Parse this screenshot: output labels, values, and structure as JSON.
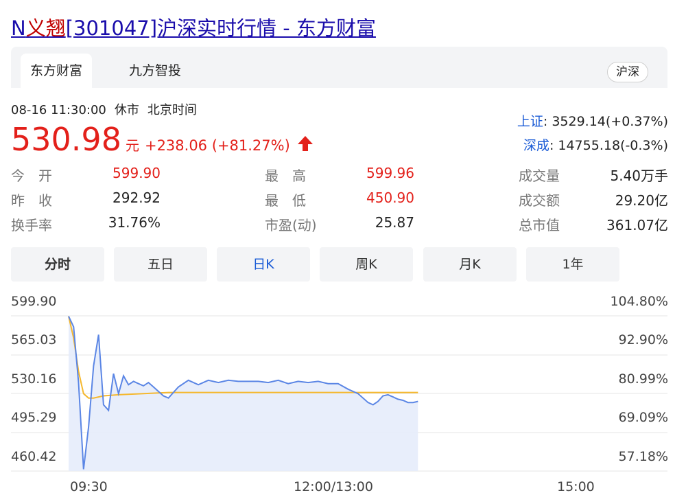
{
  "page_title": {
    "prefix": "N",
    "highlight": "义翘",
    "suffix": "[301047]沪深实时行情 - 东方财富"
  },
  "tabs": [
    {
      "label": "东方财富",
      "active": true
    },
    {
      "label": "九方智投",
      "active": false
    }
  ],
  "market_badge": "沪深",
  "status": {
    "datetime": "08-16 11:30:00",
    "state": "休市",
    "timezone": "北京时间"
  },
  "price": {
    "value": "530.98",
    "unit": "元",
    "change": "+238.06 (+81.27%)",
    "direction": "up",
    "up_color": "#e3201a"
  },
  "indices": [
    {
      "name": "上证",
      "value": ": 3529.14(+0.37%)"
    },
    {
      "name": "深成",
      "value": ": 14755.18(-0.3%)"
    }
  ],
  "quote_stats": [
    [
      {
        "label": "今　开",
        "value": "599.90",
        "color": "red"
      },
      {
        "label": "昨　收",
        "value": "292.92",
        "color": "dark"
      },
      {
        "label": "换手率",
        "value": "31.76%",
        "color": "dark"
      }
    ],
    [
      {
        "label": "最　高",
        "value": "599.96",
        "color": "red"
      },
      {
        "label": "最　低",
        "value": "450.90",
        "color": "red"
      },
      {
        "label": "市盈(动)",
        "value": "25.87",
        "color": "dark"
      }
    ],
    [
      {
        "label": "成交量",
        "value": "5.40万手",
        "color": "dark"
      },
      {
        "label": "成交额",
        "value": "29.20亿",
        "color": "dark"
      },
      {
        "label": "总市值",
        "value": "361.07亿",
        "color": "dark"
      }
    ]
  ],
  "range_tabs": [
    {
      "label": "分时",
      "selected": true
    },
    {
      "label": "五日",
      "selected": false
    },
    {
      "label": "日K",
      "selected": false
    },
    {
      "label": "周K",
      "selected": false
    },
    {
      "label": "月K",
      "selected": false
    },
    {
      "label": "1年",
      "selected": false
    }
  ],
  "chart_data": {
    "type": "line",
    "y_left_ticks": [
      "599.90",
      "565.03",
      "530.16",
      "495.29",
      "460.42"
    ],
    "y_right_ticks": [
      "104.80%",
      "92.90%",
      "80.99%",
      "69.09%",
      "57.18%"
    ],
    "x_ticks": [
      "09:30",
      "12:00/13:00",
      "15:00"
    ],
    "ylim": [
      460.42,
      599.9
    ],
    "session_minutes": 240,
    "grid": true,
    "colors": {
      "price": "#5b86e5",
      "average": "#f5b82e",
      "fill": "#e6ecfb",
      "grid": "#e5e5e5"
    },
    "series": [
      {
        "role": "price",
        "x": [
          0,
          2,
          4,
          6,
          8,
          10,
          12,
          14,
          16,
          18,
          20,
          22,
          24,
          26,
          28,
          30,
          32,
          34,
          36,
          38,
          40,
          44,
          48,
          52,
          56,
          60,
          64,
          68,
          72,
          76,
          80,
          84,
          88,
          92,
          96,
          100,
          104,
          108,
          112,
          116,
          120,
          122,
          124,
          126,
          128,
          130,
          132,
          134,
          136,
          138,
          140
        ],
        "values": [
          599.5,
          590,
          540,
          462,
          500,
          555,
          583,
          520,
          515,
          548,
          530,
          546,
          538,
          541,
          539,
          537,
          540,
          536,
          532,
          528,
          526,
          536,
          542,
          538,
          542,
          540,
          542,
          541,
          541,
          541,
          540,
          542,
          539,
          541,
          540,
          541,
          539,
          539,
          534,
          530,
          522,
          520,
          523,
          528,
          529,
          527,
          525,
          524,
          522,
          522,
          523
        ]
      },
      {
        "role": "average",
        "x": [
          0,
          2,
          4,
          6,
          8,
          10,
          12,
          14,
          20,
          30,
          40,
          60,
          80,
          100,
          120,
          140
        ],
        "values": [
          599.5,
          580,
          550,
          530,
          526,
          526,
          527,
          528,
          529,
          530,
          531,
          531,
          531,
          531,
          531,
          531
        ]
      }
    ]
  }
}
